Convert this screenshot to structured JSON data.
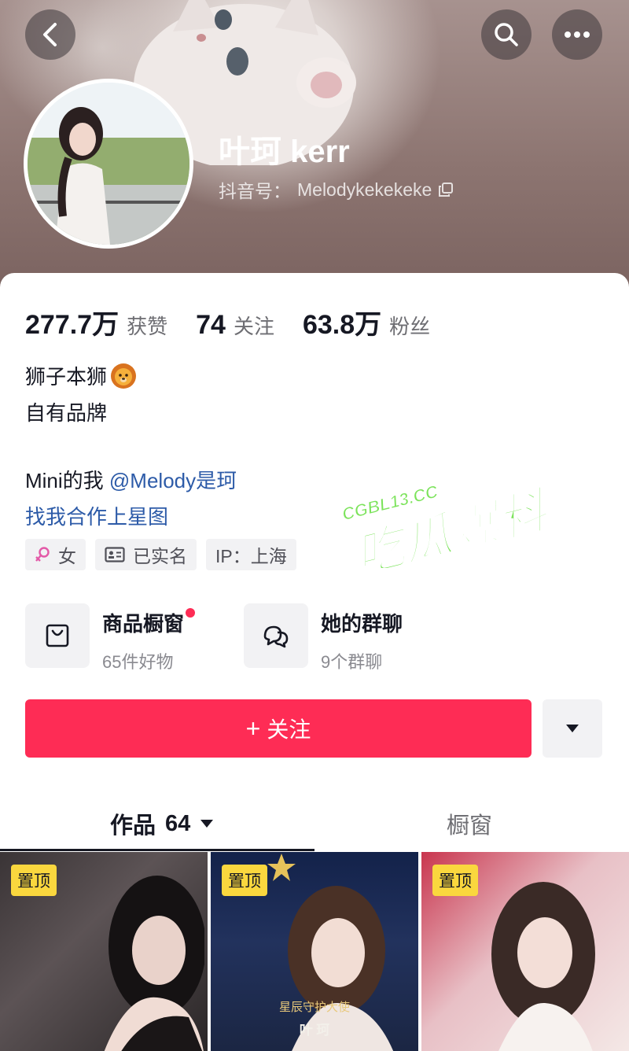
{
  "header": {
    "nickname": "叶珂 kerr",
    "douyin_id_label": "抖音号：",
    "douyin_id": "Melodykekekeke",
    "icons": {
      "back": "chevron-left-icon",
      "search": "search-icon",
      "more": "more-dots-icon",
      "copy": "copy-icon"
    }
  },
  "stats": [
    {
      "value": "277.7万",
      "label": "获赞"
    },
    {
      "value": "74",
      "label": "关注"
    },
    {
      "value": "63.8万",
      "label": "粉丝"
    }
  ],
  "bio": {
    "line1": "狮子本狮",
    "line1_emoji": "lion-face-icon",
    "line2": "自有品牌",
    "line3_prefix": "Mini的我 ",
    "line3_mention": "@Melody是珂",
    "line4": "找我合作上星图"
  },
  "tags": [
    {
      "icon": "female-icon",
      "label": "女"
    },
    {
      "icon": "id-card-icon",
      "label": "已实名"
    },
    {
      "icon": "",
      "label": "IP：上海"
    }
  ],
  "entries": {
    "shop": {
      "title": "商品橱窗",
      "subtitle": "65件好物",
      "icon": "shopping-bag-icon",
      "has_dot": true
    },
    "group": {
      "title": "她的群聊",
      "subtitle": "9个群聊",
      "icon": "chat-bubbles-icon"
    }
  },
  "follow_button": {
    "plus": "+",
    "label": "关注"
  },
  "tabs": {
    "works_label": "作品",
    "works_count": "64",
    "showcase_label": "橱窗"
  },
  "grid": [
    {
      "pinned_label": "置顶",
      "caption_top": "",
      "caption_bottom": ""
    },
    {
      "pinned_label": "置顶",
      "caption_top": "星辰守护大使",
      "caption_bottom": "叶 珂"
    },
    {
      "pinned_label": "置顶",
      "caption_top": "",
      "caption_bottom": ""
    }
  ],
  "watermark": {
    "domain": "CGBL13.CC",
    "name": "吃瓜爆料"
  },
  "colors": {
    "accent": "#fe2c55",
    "link": "#2d5ba8",
    "pin": "#fad73e",
    "watermark_green": "#7be35a",
    "watermark_pink": "#f04f8a"
  }
}
